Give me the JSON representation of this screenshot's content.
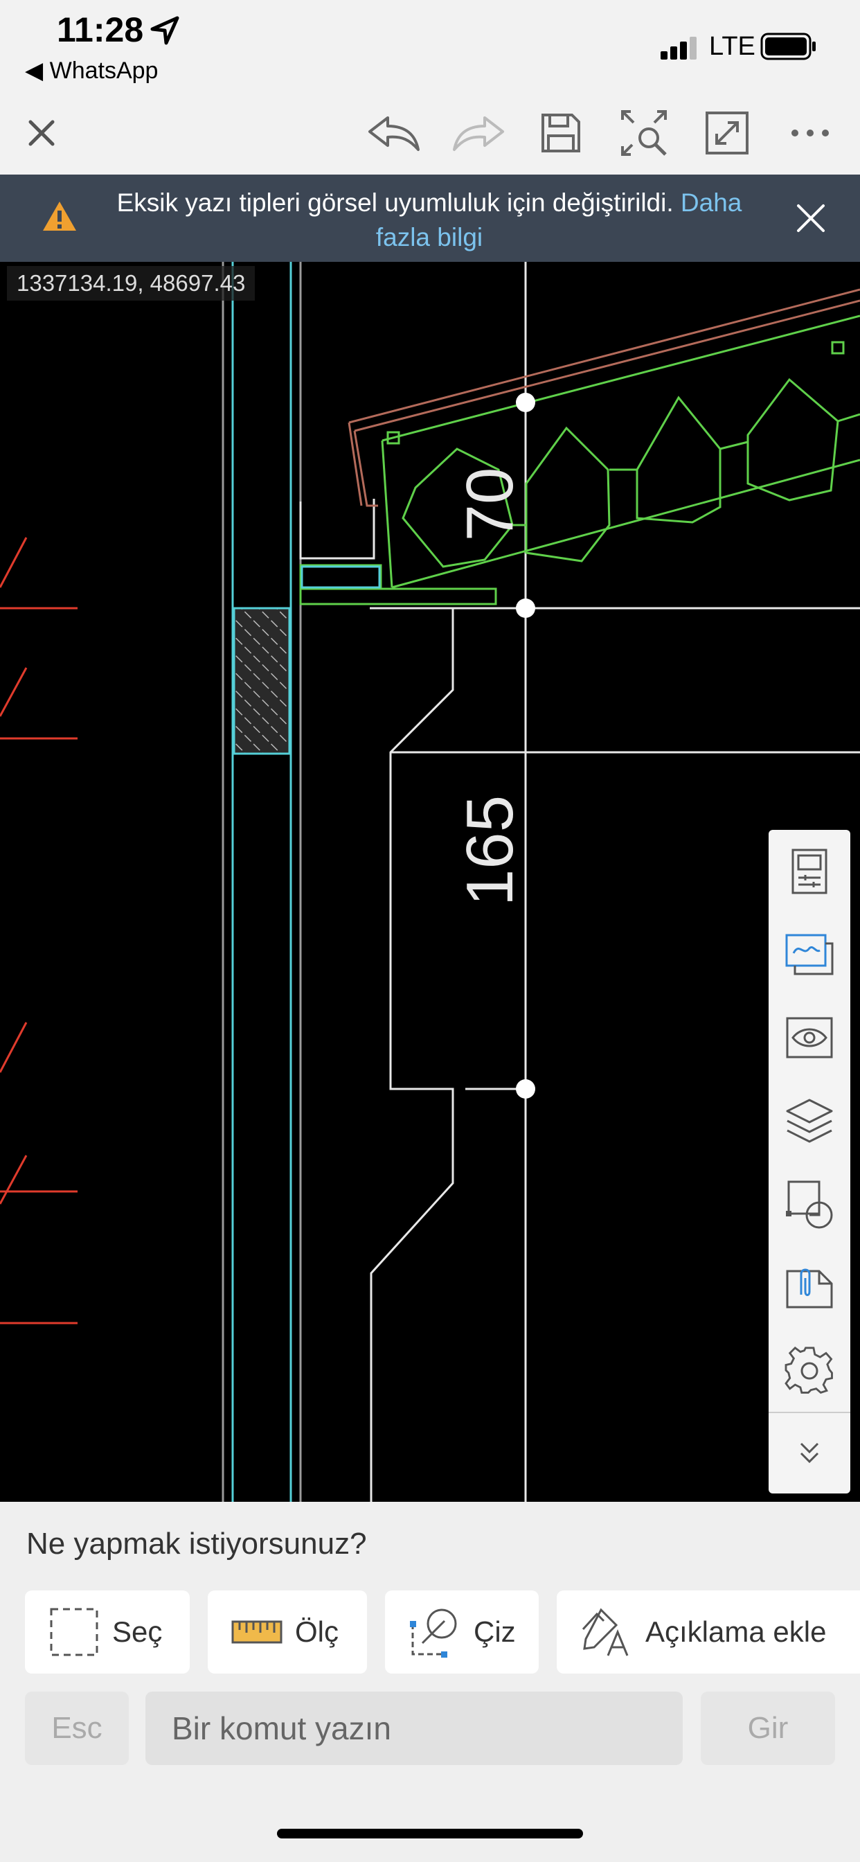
{
  "status": {
    "time": "11:28",
    "back_app": "WhatsApp",
    "network": "LTE"
  },
  "toolbar": {
    "icons": [
      "close-icon",
      "undo-icon",
      "redo-icon",
      "save-icon",
      "zoom-extents-icon",
      "fullscreen-icon",
      "more-icon"
    ]
  },
  "banner": {
    "message": "Eksik yazı tipleri görsel uyumluluk için değiştirildi.",
    "link": "Daha fazla bilgi"
  },
  "canvas": {
    "coordinates": "1337134.19,  48697.43",
    "dim_top": "70",
    "dim_mid": "165",
    "colors": {
      "white": "#e8e8e8",
      "green": "#5fd04a",
      "red": "#e03b2c",
      "cyan": "#55d0d8",
      "brown": "#b36a5a"
    }
  },
  "side_panel": {
    "icons": [
      "properties-icon",
      "layouts-icon",
      "visibility-icon",
      "layers-icon",
      "blocks-icon",
      "attachments-icon",
      "settings-icon",
      "collapse-icon"
    ]
  },
  "bottom": {
    "prompt": "Ne yapmak istiyorsunuz?",
    "tools": {
      "select": "Seç",
      "measure": "Ölç",
      "draw": "Çiz",
      "annotate": "Açıklama ekle"
    },
    "esc": "Esc",
    "command_placeholder": "Bir komut yazın",
    "enter": "Gir"
  }
}
